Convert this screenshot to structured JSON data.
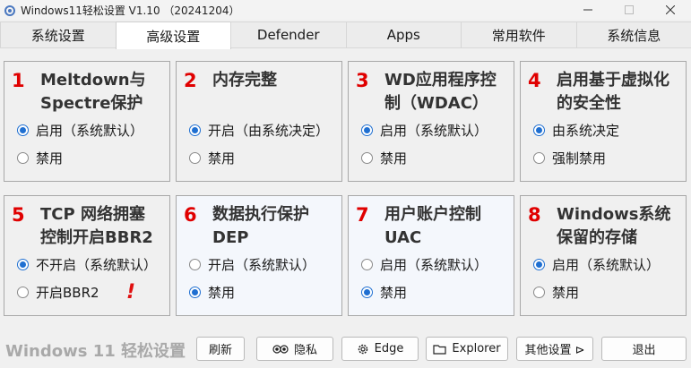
{
  "window": {
    "title": "Windows11轻松设置 V1.10 （20241204）",
    "icon": "gear-icon"
  },
  "tabs": [
    {
      "label": "系统设置",
      "active": false
    },
    {
      "label": "高级设置",
      "active": true
    },
    {
      "label": "Defender",
      "active": false
    },
    {
      "label": "Apps",
      "active": false
    },
    {
      "label": "常用软件",
      "active": false
    },
    {
      "label": "系统信息",
      "active": false
    }
  ],
  "cards": [
    {
      "num": "1",
      "title_l1": "Meltdown与",
      "title_l2": "Spectre保护",
      "opt1": "启用（系统默认）",
      "opt2": "禁用",
      "selected": 1
    },
    {
      "num": "2",
      "title_l1": "内存完整",
      "title_l2": "",
      "opt1": "开启（由系统决定）",
      "opt2": "禁用",
      "selected": 1
    },
    {
      "num": "3",
      "title_l1": "WD应用程序控",
      "title_l2": "制（WDAC）",
      "opt1": "启用（系统默认）",
      "opt2": "禁用",
      "selected": 1
    },
    {
      "num": "4",
      "title_l1": "启用基于虚拟化",
      "title_l2": "的安全性",
      "opt1": "由系统决定",
      "opt2": "强制禁用",
      "selected": 1
    },
    {
      "num": "5",
      "title_l1": "TCP 网络拥塞",
      "title_l2": "控制开启BBR2",
      "opt1": "不开启（系统默认）",
      "opt2": "开启BBR2",
      "selected": 1,
      "warn": "!"
    },
    {
      "num": "6",
      "title_l1": "数据执行保护",
      "title_l2": "DEP",
      "opt1": "开启（系统默认）",
      "opt2": "禁用",
      "selected": 2
    },
    {
      "num": "7",
      "title_l1": "用户账户控制",
      "title_l2": "UAC",
      "opt1": "启用（系统默认）",
      "opt2": "禁用",
      "selected": 2
    },
    {
      "num": "8",
      "title_l1": "Windows系统",
      "title_l2": "保留的存储",
      "opt1": "启用（系统默认）",
      "opt2": "禁用",
      "selected": 1
    }
  ],
  "footer": {
    "brand": "Windows 11 轻松设置",
    "buttons": {
      "refresh": "刷新",
      "privacy": "隐私",
      "edge": "Edge",
      "explorer": "Explorer",
      "other": "其他设置 ⊳",
      "exit": "退出"
    }
  },
  "colors": {
    "accent": "#1f6fd1",
    "number_red": "#e00000",
    "brand_gray": "#a9a9a9"
  }
}
